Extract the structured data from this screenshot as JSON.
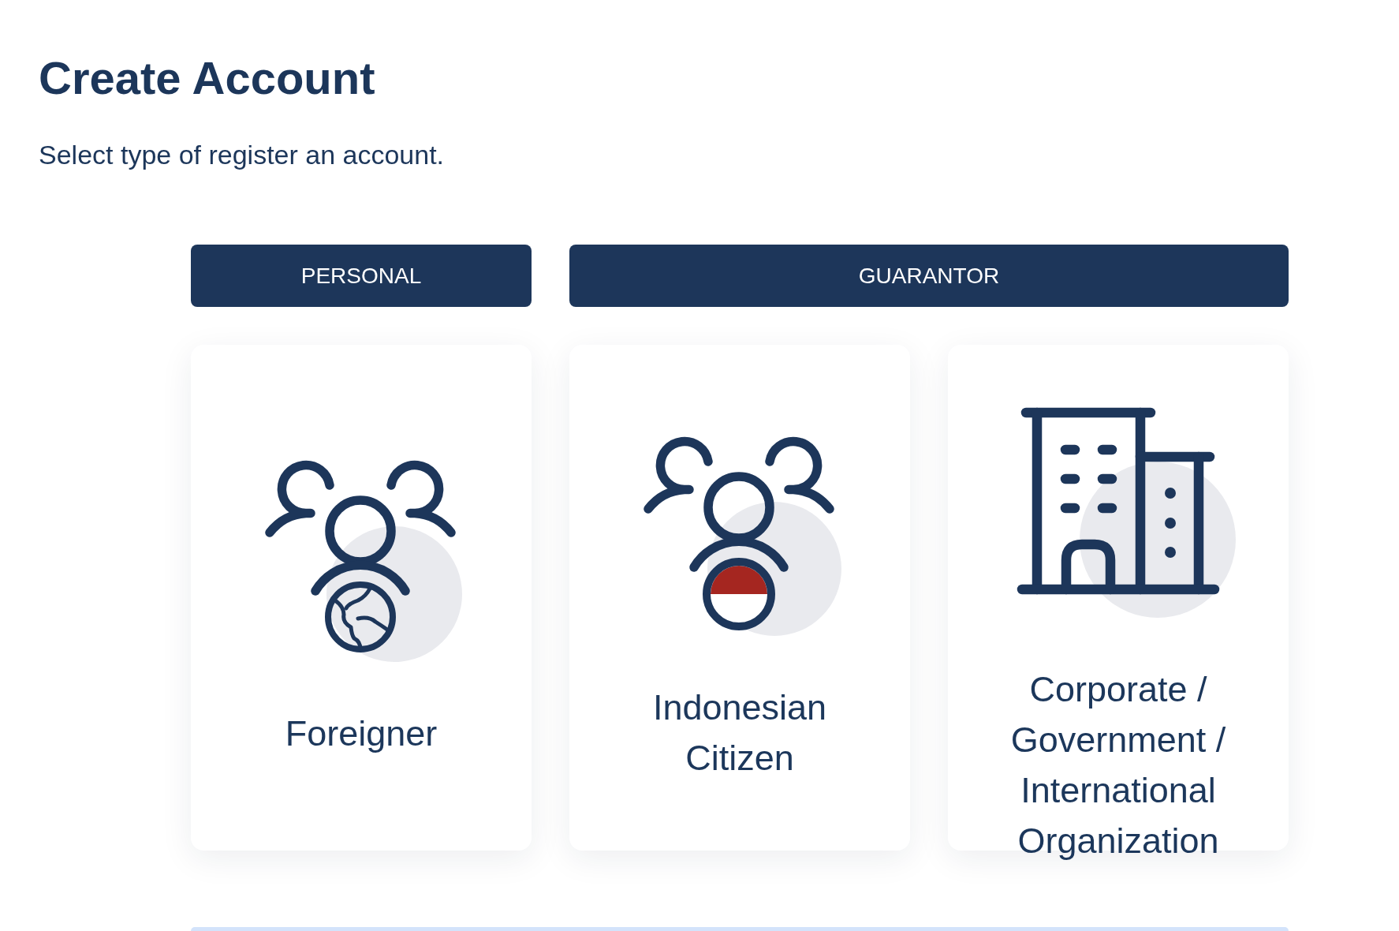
{
  "page": {
    "title": "Create Account",
    "subtitle": "Select type of register an account."
  },
  "groups": [
    {
      "label": "PERSONAL",
      "options": [
        {
          "kind": "foreigner",
          "label": "Foreigner"
        }
      ]
    },
    {
      "label": "GUARANTOR",
      "options": [
        {
          "kind": "citizen",
          "label": "Indonesian Citizen"
        },
        {
          "kind": "organization",
          "label": "Corporate / Government / International Organization"
        }
      ]
    }
  ]
}
